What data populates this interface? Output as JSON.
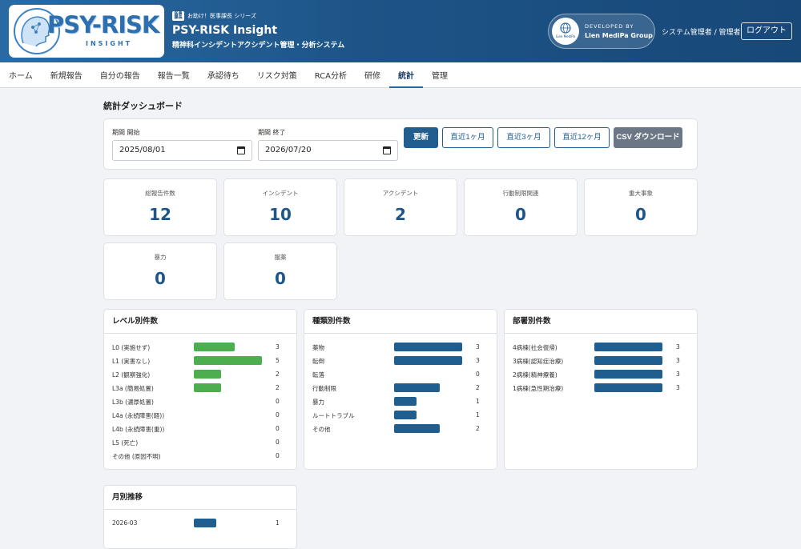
{
  "header": {
    "logo_text": "PSY-RISK",
    "logo_sub": "INSIGHT",
    "series_badge": "医事課長",
    "series_text": "お助け！医事課長 シリーズ",
    "app_title": "PSY-RISK Insight",
    "app_subtitle": "精神科インシデントアクシデント管理・分析システム",
    "dev_circle_text": "Lien MediPa",
    "dev_label": "DEVELOPED BY",
    "dev_name": "Lien MediPa Group",
    "user_label": "システム管理者 / 管理者",
    "logout_label": "ログアウト"
  },
  "nav": {
    "items": [
      "ホーム",
      "新規報告",
      "自分の報告",
      "報告一覧",
      "承認待ち",
      "リスク対策",
      "RCA分析",
      "研修",
      "統計",
      "管理"
    ],
    "active_index": 8
  },
  "page_title": "統計ダッシュボード",
  "filter": {
    "start_label": "期間 開始",
    "start_value": "2025/08/01",
    "end_label": "期間 終了",
    "end_value": "2026/07/20",
    "buttons": {
      "refresh": "更新",
      "last1": "直近1ヶ月",
      "last3": "直近3ヶ月",
      "last12": "直近12ヶ月",
      "csv": "CSV ダウンロード"
    }
  },
  "stats": [
    {
      "label": "総報告件数",
      "value": "12"
    },
    {
      "label": "インシデント",
      "value": "10"
    },
    {
      "label": "アクシデント",
      "value": "2"
    },
    {
      "label": "行動制限関連",
      "value": "0"
    },
    {
      "label": "重大事象",
      "value": "0"
    },
    {
      "label": "暴力",
      "value": "0"
    },
    {
      "label": "服薬",
      "value": "0"
    }
  ],
  "colors": {
    "green": "#4cae4f",
    "blue": "#1f5e8e"
  },
  "panels": {
    "level": {
      "title": "レベル別件数",
      "max": 5,
      "rows": [
        {
          "label": "L0 (実施せず)",
          "count": 3
        },
        {
          "label": "L1 (実害なし)",
          "count": 5
        },
        {
          "label": "L2 (観察強化)",
          "count": 2
        },
        {
          "label": "L3a (簡易処置)",
          "count": 2
        },
        {
          "label": "L3b (濃厚処置)",
          "count": 0
        },
        {
          "label": "L4a (永続障害(軽))",
          "count": 0
        },
        {
          "label": "L4b (永続障害(重))",
          "count": 0
        },
        {
          "label": "L5 (死亡)",
          "count": 0
        },
        {
          "label": "その他 (原因不明)",
          "count": 0
        }
      ]
    },
    "type": {
      "title": "種類別件数",
      "max": 3,
      "rows": [
        {
          "label": "薬物",
          "count": 3
        },
        {
          "label": "転倒",
          "count": 3
        },
        {
          "label": "転落",
          "count": 0
        },
        {
          "label": "行動制限",
          "count": 2
        },
        {
          "label": "暴力",
          "count": 1
        },
        {
          "label": "ルートトラブル",
          "count": 1
        },
        {
          "label": "その他",
          "count": 2
        }
      ]
    },
    "dept": {
      "title": "部署別件数",
      "max": 3,
      "rows": [
        {
          "label": "4病棟(社会復帰)",
          "count": 3
        },
        {
          "label": "3病棟(認知症治療)",
          "count": 3
        },
        {
          "label": "2病棟(精神療養)",
          "count": 3
        },
        {
          "label": "1病棟(急性期治療)",
          "count": 3
        }
      ]
    },
    "monthly": {
      "title": "月別推移",
      "max": 3,
      "rows": [
        {
          "label": "2026-03",
          "count": 1
        }
      ]
    }
  }
}
